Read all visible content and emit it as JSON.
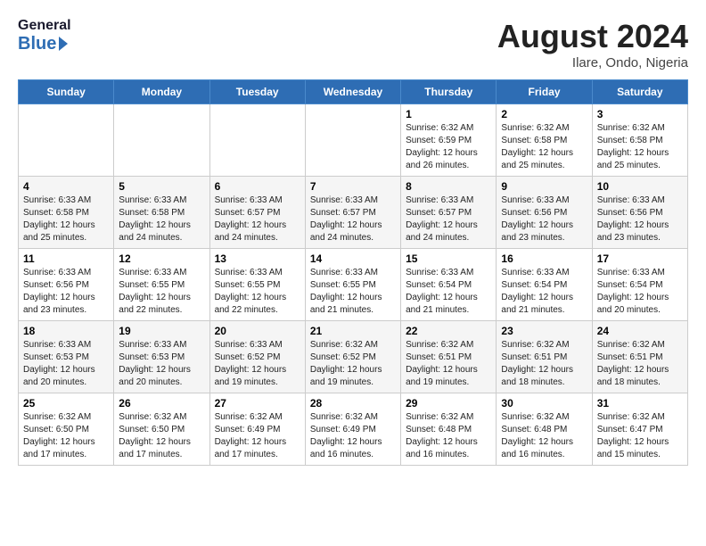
{
  "logo": {
    "line1": "General",
    "line2": "Blue"
  },
  "header": {
    "title": "August 2024",
    "subtitle": "Ilare, Ondo, Nigeria"
  },
  "days_of_week": [
    "Sunday",
    "Monday",
    "Tuesday",
    "Wednesday",
    "Thursday",
    "Friday",
    "Saturday"
  ],
  "weeks": [
    [
      {
        "day": null,
        "info": null
      },
      {
        "day": null,
        "info": null
      },
      {
        "day": null,
        "info": null
      },
      {
        "day": null,
        "info": null
      },
      {
        "day": "1",
        "info": "Sunrise: 6:32 AM\nSunset: 6:59 PM\nDaylight: 12 hours\nand 26 minutes."
      },
      {
        "day": "2",
        "info": "Sunrise: 6:32 AM\nSunset: 6:58 PM\nDaylight: 12 hours\nand 25 minutes."
      },
      {
        "day": "3",
        "info": "Sunrise: 6:32 AM\nSunset: 6:58 PM\nDaylight: 12 hours\nand 25 minutes."
      }
    ],
    [
      {
        "day": "4",
        "info": "Sunrise: 6:33 AM\nSunset: 6:58 PM\nDaylight: 12 hours\nand 25 minutes."
      },
      {
        "day": "5",
        "info": "Sunrise: 6:33 AM\nSunset: 6:58 PM\nDaylight: 12 hours\nand 24 minutes."
      },
      {
        "day": "6",
        "info": "Sunrise: 6:33 AM\nSunset: 6:57 PM\nDaylight: 12 hours\nand 24 minutes."
      },
      {
        "day": "7",
        "info": "Sunrise: 6:33 AM\nSunset: 6:57 PM\nDaylight: 12 hours\nand 24 minutes."
      },
      {
        "day": "8",
        "info": "Sunrise: 6:33 AM\nSunset: 6:57 PM\nDaylight: 12 hours\nand 24 minutes."
      },
      {
        "day": "9",
        "info": "Sunrise: 6:33 AM\nSunset: 6:56 PM\nDaylight: 12 hours\nand 23 minutes."
      },
      {
        "day": "10",
        "info": "Sunrise: 6:33 AM\nSunset: 6:56 PM\nDaylight: 12 hours\nand 23 minutes."
      }
    ],
    [
      {
        "day": "11",
        "info": "Sunrise: 6:33 AM\nSunset: 6:56 PM\nDaylight: 12 hours\nand 23 minutes."
      },
      {
        "day": "12",
        "info": "Sunrise: 6:33 AM\nSunset: 6:55 PM\nDaylight: 12 hours\nand 22 minutes."
      },
      {
        "day": "13",
        "info": "Sunrise: 6:33 AM\nSunset: 6:55 PM\nDaylight: 12 hours\nand 22 minutes."
      },
      {
        "day": "14",
        "info": "Sunrise: 6:33 AM\nSunset: 6:55 PM\nDaylight: 12 hours\nand 21 minutes."
      },
      {
        "day": "15",
        "info": "Sunrise: 6:33 AM\nSunset: 6:54 PM\nDaylight: 12 hours\nand 21 minutes."
      },
      {
        "day": "16",
        "info": "Sunrise: 6:33 AM\nSunset: 6:54 PM\nDaylight: 12 hours\nand 21 minutes."
      },
      {
        "day": "17",
        "info": "Sunrise: 6:33 AM\nSunset: 6:54 PM\nDaylight: 12 hours\nand 20 minutes."
      }
    ],
    [
      {
        "day": "18",
        "info": "Sunrise: 6:33 AM\nSunset: 6:53 PM\nDaylight: 12 hours\nand 20 minutes."
      },
      {
        "day": "19",
        "info": "Sunrise: 6:33 AM\nSunset: 6:53 PM\nDaylight: 12 hours\nand 20 minutes."
      },
      {
        "day": "20",
        "info": "Sunrise: 6:33 AM\nSunset: 6:52 PM\nDaylight: 12 hours\nand 19 minutes."
      },
      {
        "day": "21",
        "info": "Sunrise: 6:32 AM\nSunset: 6:52 PM\nDaylight: 12 hours\nand 19 minutes."
      },
      {
        "day": "22",
        "info": "Sunrise: 6:32 AM\nSunset: 6:51 PM\nDaylight: 12 hours\nand 19 minutes."
      },
      {
        "day": "23",
        "info": "Sunrise: 6:32 AM\nSunset: 6:51 PM\nDaylight: 12 hours\nand 18 minutes."
      },
      {
        "day": "24",
        "info": "Sunrise: 6:32 AM\nSunset: 6:51 PM\nDaylight: 12 hours\nand 18 minutes."
      }
    ],
    [
      {
        "day": "25",
        "info": "Sunrise: 6:32 AM\nSunset: 6:50 PM\nDaylight: 12 hours\nand 17 minutes."
      },
      {
        "day": "26",
        "info": "Sunrise: 6:32 AM\nSunset: 6:50 PM\nDaylight: 12 hours\nand 17 minutes."
      },
      {
        "day": "27",
        "info": "Sunrise: 6:32 AM\nSunset: 6:49 PM\nDaylight: 12 hours\nand 17 minutes."
      },
      {
        "day": "28",
        "info": "Sunrise: 6:32 AM\nSunset: 6:49 PM\nDaylight: 12 hours\nand 16 minutes."
      },
      {
        "day": "29",
        "info": "Sunrise: 6:32 AM\nSunset: 6:48 PM\nDaylight: 12 hours\nand 16 minutes."
      },
      {
        "day": "30",
        "info": "Sunrise: 6:32 AM\nSunset: 6:48 PM\nDaylight: 12 hours\nand 16 minutes."
      },
      {
        "day": "31",
        "info": "Sunrise: 6:32 AM\nSunset: 6:47 PM\nDaylight: 12 hours\nand 15 minutes."
      }
    ]
  ]
}
